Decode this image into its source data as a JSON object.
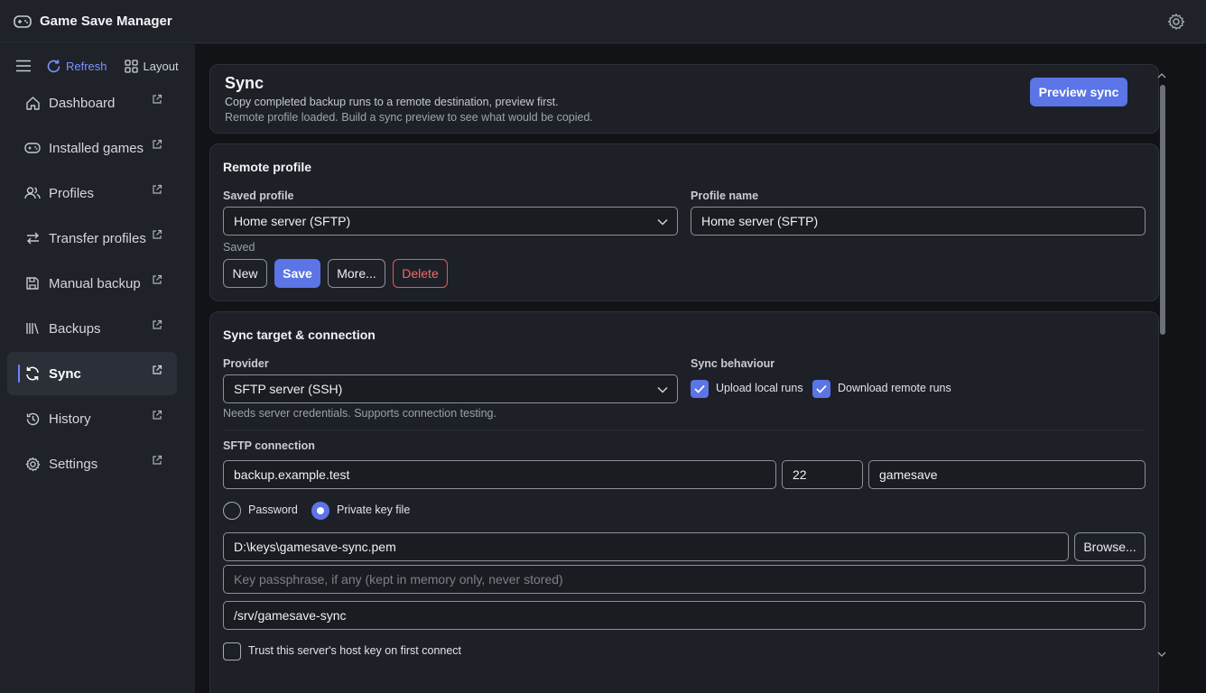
{
  "app": {
    "title": "Game Save Manager"
  },
  "sidebar": {
    "toolbar": {
      "refresh_label": "Refresh",
      "layout_label": "Layout"
    },
    "items": [
      {
        "label": "Dashboard",
        "icon": "home-icon",
        "active": false
      },
      {
        "label": "Installed games",
        "icon": "gamepad-icon",
        "active": false
      },
      {
        "label": "Profiles",
        "icon": "users-icon",
        "active": false
      },
      {
        "label": "Transfer profiles",
        "icon": "transfer-icon",
        "active": false
      },
      {
        "label": "Manual backup",
        "icon": "save-disk-icon",
        "active": false
      },
      {
        "label": "Backups",
        "icon": "library-icon",
        "active": false
      },
      {
        "label": "Sync",
        "icon": "sync-icon",
        "active": true
      },
      {
        "label": "History",
        "icon": "history-icon",
        "active": false
      },
      {
        "label": "Settings",
        "icon": "gear-icon",
        "active": false
      }
    ]
  },
  "header": {
    "title": "Sync",
    "subtitle": "Copy completed backup runs to a remote destination, preview first.",
    "status": "Remote profile loaded. Build a sync preview to see what would be copied.",
    "preview_button": "Preview sync"
  },
  "remote_profile": {
    "section_title": "Remote profile",
    "saved_profile_label": "Saved profile",
    "saved_profile_value": "Home server (SFTP)",
    "profile_name_label": "Profile name",
    "profile_name_value": "Home server (SFTP)",
    "saved_state": "Saved",
    "buttons": {
      "new": "New",
      "save": "Save",
      "more": "More...",
      "delete": "Delete"
    }
  },
  "sync_target": {
    "section_title": "Sync target & connection",
    "provider_label": "Provider",
    "provider_value": "SFTP server (SSH)",
    "provider_note": "Needs server credentials. Supports connection testing.",
    "behaviour_label": "Sync behaviour",
    "upload_label": "Upload local runs",
    "upload_checked": true,
    "download_label": "Download remote runs",
    "download_checked": true,
    "sftp_label": "SFTP connection",
    "host": "backup.example.test",
    "port": "22",
    "username": "gamesave",
    "auth_password_label": "Password",
    "auth_key_label": "Private key file",
    "auth_selected": "Private key file",
    "key_path": "D:\\keys\\gamesave-sync.pem",
    "browse_button": "Browse...",
    "passphrase_placeholder": "Key passphrase, if any (kept in memory only, never stored)",
    "remote_path": "/srv/gamesave-sync",
    "trust_label": "Trust this server's host key on first connect",
    "trust_checked": false
  },
  "colors": {
    "accent": "#5b74e6",
    "danger": "#ef6b6b",
    "link": "#7b93ff"
  }
}
